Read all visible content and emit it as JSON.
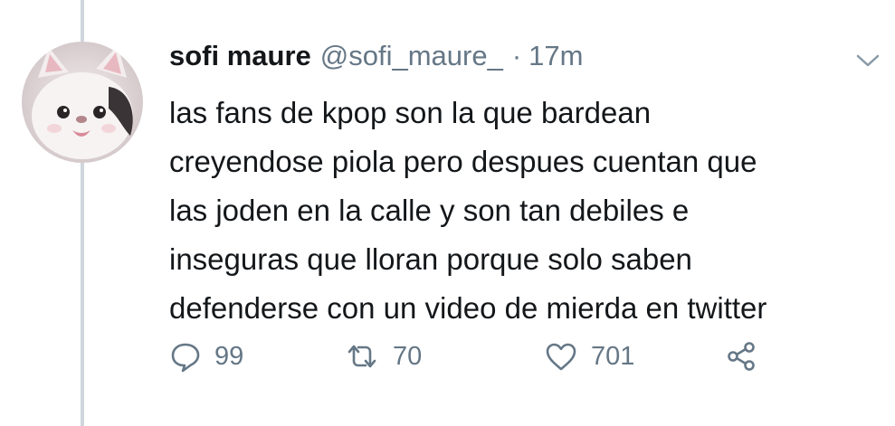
{
  "tweet": {
    "author": {
      "display_name": "sofi maure",
      "handle": "@sofi_maure_",
      "avatar_icon": "cat-avatar-icon"
    },
    "separator": "·",
    "timestamp": "17m",
    "text_lines": [
      "las fans de kpop son la que bardean",
      "creyendose piola pero despues cuentan que",
      "las joden en la calle y son tan debiles e",
      "inseguras que lloran porque solo saben",
      "defenderse con un video de mierda en twitter"
    ],
    "menu_icon": "chevron-down-icon",
    "actions": {
      "replies": "99",
      "retweets": "70",
      "likes": "701",
      "reply_icon": "reply-icon",
      "retweet_icon": "retweet-icon",
      "like_icon": "heart-icon",
      "share_icon": "share-icon"
    }
  },
  "colors": {
    "text": "#14171a",
    "secondary": "#657786",
    "thread_line": "#cfd6dc",
    "background": "#ffffff"
  }
}
